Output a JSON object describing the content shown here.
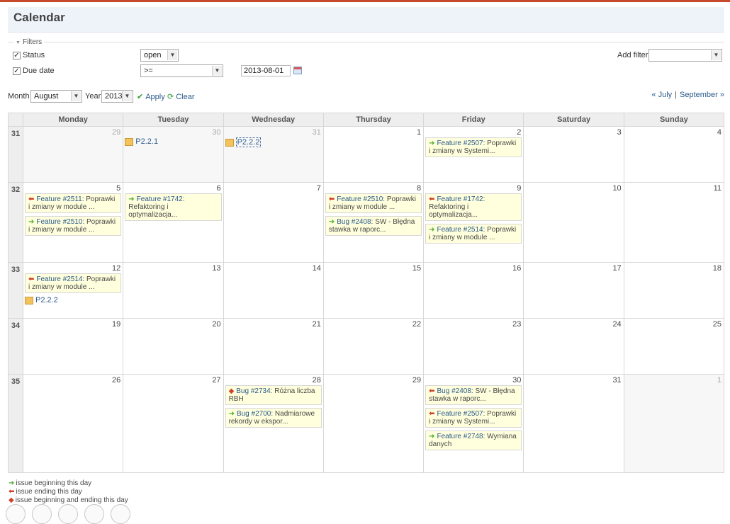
{
  "page": {
    "title": "Calendar"
  },
  "filters": {
    "legend": "Filters",
    "status": {
      "label": "Status",
      "checked": "✓",
      "operator": "open"
    },
    "due_date": {
      "label": "Due date",
      "checked": "✓",
      "operator": ">=",
      "value": "2013-08-01"
    },
    "add_filter_label": "Add filter",
    "add_filter_value": ""
  },
  "controls": {
    "month_label": "Month",
    "month_value": "August",
    "year_label": "Year",
    "year_value": "2013",
    "apply_label": "Apply",
    "clear_label": "Clear",
    "prev_month": "« July",
    "separator": "|",
    "next_month": "September »"
  },
  "calendar": {
    "weekdays": [
      "Monday",
      "Tuesday",
      "Wednesday",
      "Thursday",
      "Friday",
      "Saturday",
      "Sunday"
    ],
    "weeks": [
      {
        "num": "31",
        "days": [
          {
            "d": "29",
            "other": true,
            "items": []
          },
          {
            "d": "30",
            "other": true,
            "items": [
              {
                "kind": "version",
                "label": "P2.2.1"
              }
            ]
          },
          {
            "d": "31",
            "other": true,
            "items": [
              {
                "kind": "version",
                "label": "P2.2.2",
                "boxed": true
              }
            ]
          },
          {
            "d": "1",
            "items": []
          },
          {
            "d": "2",
            "items": [
              {
                "kind": "issue",
                "arrow": "start",
                "link": "Feature #2507",
                "text": "Poprawki i zmiany w Systemi..."
              }
            ]
          },
          {
            "d": "3",
            "items": []
          },
          {
            "d": "4",
            "items": []
          }
        ]
      },
      {
        "num": "32",
        "days": [
          {
            "d": "5",
            "items": [
              {
                "kind": "issue",
                "arrow": "end",
                "link": "Feature #2511",
                "text": "Poprawki i zmiany w module ..."
              },
              {
                "kind": "issue",
                "arrow": "start",
                "link": "Feature #2510",
                "text": "Poprawki i zmiany w module ..."
              }
            ]
          },
          {
            "d": "6",
            "items": [
              {
                "kind": "issue",
                "arrow": "start",
                "link": "Feature #1742",
                "text": "Refaktoring i optymalizacja..."
              }
            ]
          },
          {
            "d": "7",
            "items": []
          },
          {
            "d": "8",
            "items": [
              {
                "kind": "issue",
                "arrow": "end",
                "link": "Feature #2510",
                "text": "Poprawki i zmiany w module ..."
              },
              {
                "kind": "issue",
                "arrow": "start",
                "link": "Bug #2408",
                "text": "SW - Błędna stawka w raporc..."
              }
            ]
          },
          {
            "d": "9",
            "items": [
              {
                "kind": "issue",
                "arrow": "end",
                "link": "Feature #1742",
                "text": "Refaktoring i optymalizacja..."
              },
              {
                "kind": "issue",
                "arrow": "start",
                "link": "Feature #2514",
                "text": "Poprawki i zmiany w module ..."
              }
            ]
          },
          {
            "d": "10",
            "items": []
          },
          {
            "d": "11",
            "items": []
          }
        ]
      },
      {
        "num": "33",
        "days": [
          {
            "d": "12",
            "items": [
              {
                "kind": "issue",
                "arrow": "end",
                "link": "Feature #2514",
                "text": "Poprawki i zmiany w module ..."
              },
              {
                "kind": "version",
                "label": "P2.2.2"
              }
            ]
          },
          {
            "d": "13",
            "items": []
          },
          {
            "d": "14",
            "items": []
          },
          {
            "d": "15",
            "items": []
          },
          {
            "d": "16",
            "items": []
          },
          {
            "d": "17",
            "items": []
          },
          {
            "d": "18",
            "items": []
          }
        ]
      },
      {
        "num": "34",
        "days": [
          {
            "d": "19",
            "items": []
          },
          {
            "d": "20",
            "items": []
          },
          {
            "d": "21",
            "items": []
          },
          {
            "d": "22",
            "items": []
          },
          {
            "d": "23",
            "items": []
          },
          {
            "d": "24",
            "items": []
          },
          {
            "d": "25",
            "items": []
          }
        ]
      },
      {
        "num": "35",
        "days": [
          {
            "d": "26",
            "items": []
          },
          {
            "d": "27",
            "items": []
          },
          {
            "d": "28",
            "items": [
              {
                "kind": "issue",
                "arrow": "both",
                "link": "Bug #2734",
                "text": "Różna liczba RBH"
              },
              {
                "kind": "issue",
                "arrow": "start",
                "link": "Bug #2700",
                "text": "Nadmiarowe rekordy w ekspor..."
              }
            ]
          },
          {
            "d": "29",
            "items": []
          },
          {
            "d": "30",
            "items": [
              {
                "kind": "issue",
                "arrow": "end",
                "link": "Bug #2408",
                "text": "SW - Błędna stawka w raporc..."
              },
              {
                "kind": "issue",
                "arrow": "end",
                "link": "Feature #2507",
                "text": "Poprawki i zmiany w Systemi..."
              },
              {
                "kind": "issue",
                "arrow": "start",
                "link": "Feature #2748",
                "text": "Wymiana danych"
              }
            ]
          },
          {
            "d": "31",
            "items": []
          },
          {
            "d": "1",
            "other": true,
            "items": []
          }
        ]
      }
    ]
  },
  "legend": {
    "start": "issue beginning this day",
    "end": "issue ending this day",
    "both": "issue beginning and ending this day"
  },
  "icons": {
    "start": "arrow-right-icon",
    "end": "arrow-left-icon",
    "both": "diamond-icon",
    "version": "package-icon"
  }
}
